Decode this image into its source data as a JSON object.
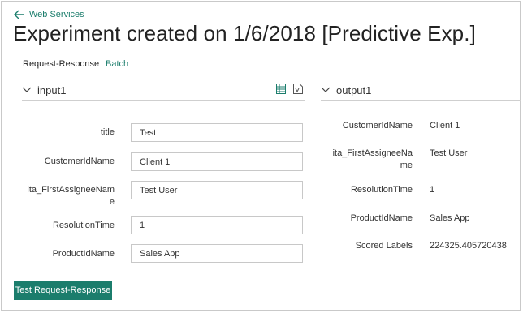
{
  "header": {
    "back_link": "Web Services",
    "title": "Experiment created on 1/6/2018 [Predictive Exp.]"
  },
  "tabs": [
    {
      "label": "Request-Response",
      "active": true
    },
    {
      "label": "Batch",
      "active": false
    }
  ],
  "input_panel": {
    "title": "input1",
    "fields": [
      {
        "label": "title",
        "value": "Test"
      },
      {
        "label": "CustomerIdName",
        "value": "Client 1"
      },
      {
        "label_line1": "ita_FirstAssigneeNam",
        "label_line2": "e",
        "value": "Test User"
      },
      {
        "label": "ResolutionTime",
        "value": "1"
      },
      {
        "label": "ProductIdName",
        "value": "Sales App"
      }
    ]
  },
  "output_panel": {
    "title": "output1",
    "fields": [
      {
        "label": "CustomerIdName",
        "value": "Client 1"
      },
      {
        "label_line1": "ita_FirstAssigneeNa",
        "label_line2": "me",
        "value": "Test User"
      },
      {
        "label": "ResolutionTime",
        "value": "1"
      },
      {
        "label": "ProductIdName",
        "value": "Sales App"
      },
      {
        "label": "Scored Labels",
        "value": "224325.405720438"
      }
    ]
  },
  "actions": {
    "submit_label": "Test Request-Response"
  },
  "colors": {
    "accent": "#1b7d6c"
  },
  "icons": [
    "back-arrow-icon",
    "chevron-down-icon",
    "table-view-icon",
    "csv-file-icon"
  ]
}
